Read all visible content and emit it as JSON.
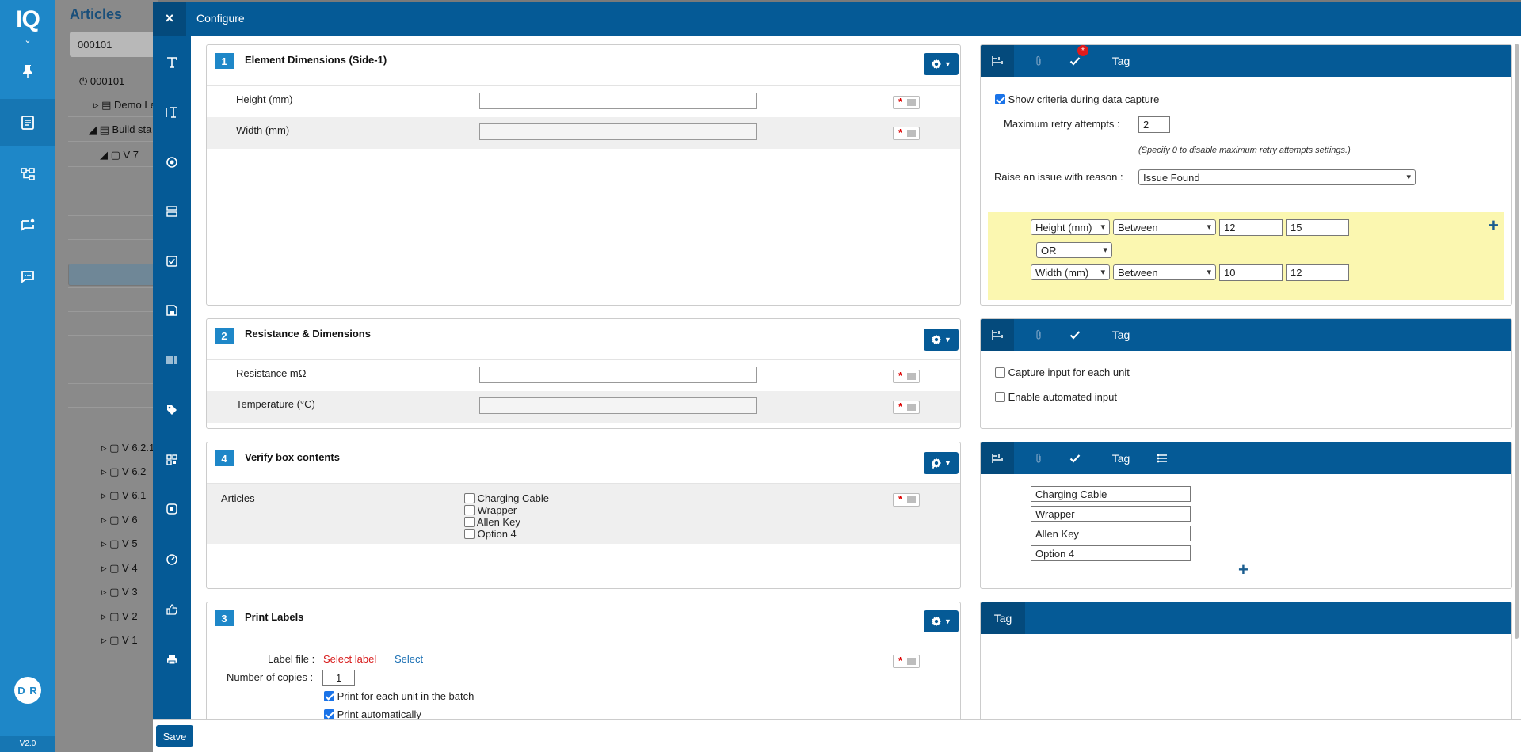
{
  "nav": {
    "logo": "IQ",
    "user_initials": "D R",
    "version": "V2.0"
  },
  "tree": {
    "title": "Articles",
    "search_value": "000101",
    "items": [
      {
        "text": "⏻ 000101"
      },
      {
        "text": "Demo Le"
      },
      {
        "text": "Build sta"
      },
      {
        "text": "V 7"
      },
      {
        "text": "V 6.2.1"
      },
      {
        "text": "V 6.2"
      },
      {
        "text": "V 6.1"
      },
      {
        "text": "V 6"
      },
      {
        "text": "V 5"
      },
      {
        "text": "V 4"
      },
      {
        "text": "V 3"
      },
      {
        "text": "V 2"
      },
      {
        "text": "V 1"
      }
    ]
  },
  "modal": {
    "title": "Configure",
    "close_label": "×",
    "save_label": "Save"
  },
  "cards": {
    "c1": {
      "number": "1",
      "title": "Element Dimensions (Side-1)",
      "fields": [
        {
          "label": "Height (mm)"
        },
        {
          "label": "Width (mm)"
        }
      ]
    },
    "c2": {
      "number": "2",
      "title": "Resistance & Dimensions",
      "fields": [
        {
          "label": "Resistance mΩ"
        },
        {
          "label": "Temperature (°C)"
        }
      ]
    },
    "c4": {
      "number": "4",
      "title": "Verify box contents",
      "label": "Articles",
      "options": [
        "Charging Cable",
        "Wrapper",
        "Allen Key",
        "Option 4"
      ]
    },
    "c3": {
      "number": "3",
      "title": "Print Labels",
      "label_file_label": "Label file :",
      "select_label_link": "Select label",
      "select_link": "Select",
      "copies_label": "Number of copies :",
      "copies_value": "1",
      "print_each_label": "Print for each unit in the batch",
      "print_auto_label": "Print automatically"
    }
  },
  "panels": {
    "p1": {
      "tab_tag": "Tag",
      "badge": "*",
      "show_criteria_label": "Show criteria during data capture",
      "max_retry_label": "Maximum retry attempts :",
      "max_retry_value": "2",
      "retry_hint": "(Specify 0 to disable maximum retry attempts settings.)",
      "raise_issue_label": "Raise an issue with reason :",
      "raise_issue_value": "Issue Found",
      "criteria": [
        {
          "field": "Height (mm)",
          "op": "Between",
          "min": "12",
          "max": "15"
        },
        {
          "field": "Width (mm)",
          "op": "Between",
          "min": "10",
          "max": "12"
        }
      ],
      "join": "OR"
    },
    "p2": {
      "tab_tag": "Tag",
      "capture_each_label": "Capture input for each unit",
      "automated_label": "Enable automated input"
    },
    "p3": {
      "tab_tag": "Tag",
      "options": [
        "Charging Cable",
        "Wrapper",
        "Allen Key",
        "Option 4"
      ]
    },
    "p4": {
      "tab_tag": "Tag"
    }
  }
}
